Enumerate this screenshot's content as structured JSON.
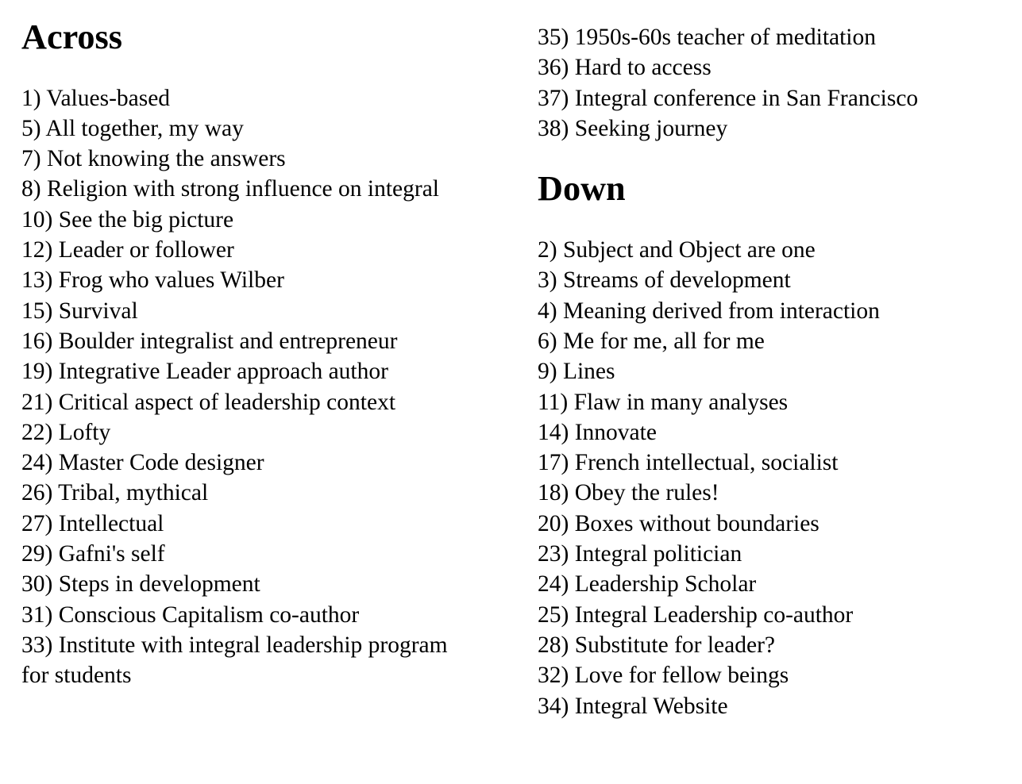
{
  "across": {
    "heading": "Across",
    "clues": [
      {
        "number": "1)",
        "text": "Values-based"
      },
      {
        "number": "5)",
        "text": "All together, my way"
      },
      {
        "number": "7)",
        "text": "Not knowing the answers"
      },
      {
        "number": "8)",
        "text": "Religion with strong influence on integral"
      },
      {
        "number": "10)",
        "text": "See the big picture"
      },
      {
        "number": "12)",
        "text": "Leader or follower"
      },
      {
        "number": "13)",
        "text": "Frog who values Wilber"
      },
      {
        "number": "15)",
        "text": "Survival"
      },
      {
        "number": "16)",
        "text": "Boulder integralist and entrepreneur"
      },
      {
        "number": "19)",
        "text": "Integrative Leader approach author"
      },
      {
        "number": "21)",
        "text": "Critical aspect of leadership context"
      },
      {
        "number": "22)",
        "text": "Lofty"
      },
      {
        "number": "24)",
        "text": "Master Code designer"
      },
      {
        "number": "26)",
        "text": "Tribal, mythical"
      },
      {
        "number": "27)",
        "text": "Intellectual"
      },
      {
        "number": "29)",
        "text": "Gafni's self"
      },
      {
        "number": "30)",
        "text": "Steps in development"
      },
      {
        "number": "31)",
        "text": "Conscious Capitalism co-author"
      },
      {
        "number": "33)",
        "text": "Institute with integral leadership program for students"
      },
      {
        "number": "35)",
        "text": "1950s-60s teacher of meditation"
      },
      {
        "number": "36)",
        "text": "Hard to access"
      },
      {
        "number": "37)",
        "text": "Integral conference in San Francisco"
      },
      {
        "number": "38)",
        "text": "Seeking journey"
      }
    ]
  },
  "down": {
    "heading": "Down",
    "clues": [
      {
        "number": "2)",
        "text": "Subject and Object are one"
      },
      {
        "number": "3)",
        "text": "Streams of development"
      },
      {
        "number": "4)",
        "text": "Meaning derived from interaction"
      },
      {
        "number": "6)",
        "text": "Me for me, all for me"
      },
      {
        "number": "9)",
        "text": "Lines"
      },
      {
        "number": "11)",
        "text": "Flaw in many analyses"
      },
      {
        "number": "14)",
        "text": "Innovate"
      },
      {
        "number": "17)",
        "text": "French intellectual, socialist"
      },
      {
        "number": "18)",
        "text": "Obey the rules!"
      },
      {
        "number": "20)",
        "text": "Boxes without boundaries"
      },
      {
        "number": "23)",
        "text": "Integral politician"
      },
      {
        "number": "24)",
        "text": "Leadership Scholar"
      },
      {
        "number": "25)",
        "text": "Integral Leadership co-author"
      },
      {
        "number": "28)",
        "text": "Substitute for leader?"
      },
      {
        "number": "32)",
        "text": "Love for fellow beings"
      },
      {
        "number": "34)",
        "text": "Integral Website"
      }
    ]
  }
}
